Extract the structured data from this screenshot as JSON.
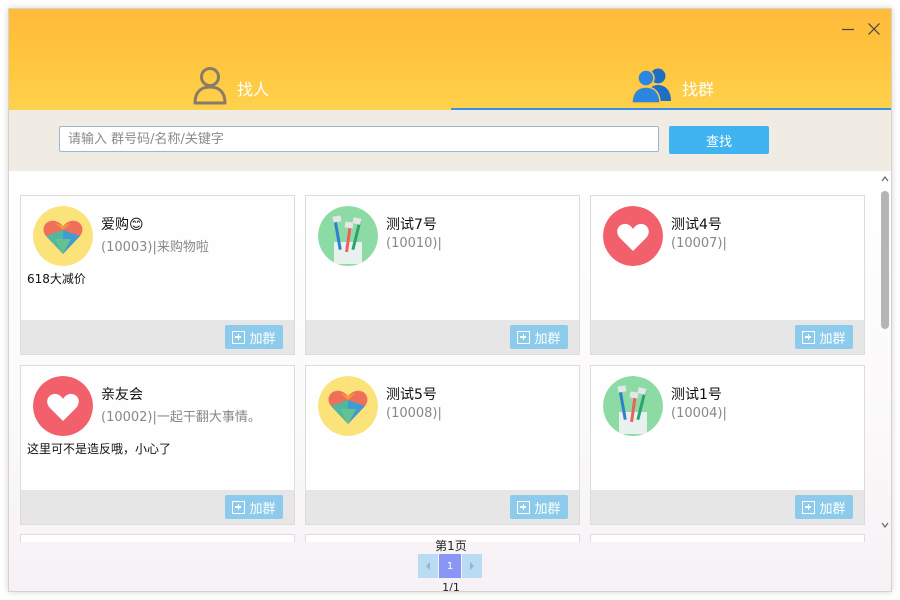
{
  "window": {
    "controls": {
      "minimize_icon": "minimize-icon",
      "close_icon": "close-icon"
    },
    "tabs": [
      {
        "label": "找人",
        "icon": "person-icon",
        "active": false
      },
      {
        "label": "找群",
        "icon": "group-icon",
        "active": true
      }
    ]
  },
  "search": {
    "placeholder": "请输入 群号码/名称/关键字",
    "value": "",
    "button_label": "查找"
  },
  "colors": {
    "header_gradient_top": "#ffbb3a",
    "tab_active_underline": "#3b8fe6",
    "search_button": "#3fb4f0",
    "join_button": "#8ccbeb",
    "page_current": "#8b95f5"
  },
  "groups": [
    {
      "name": "爱购😊",
      "sub": "(10003)|来购物啦",
      "desc": "618大减价",
      "avatar": "heart-gem-icon",
      "join_label": "加群"
    },
    {
      "name": "测试7号",
      "sub": "(10010)|",
      "desc": "",
      "avatar": "toothbrush-icon",
      "join_label": "加群"
    },
    {
      "name": "测试4号",
      "sub": "(10007)|",
      "desc": "",
      "avatar": "heart-icon",
      "join_label": "加群"
    },
    {
      "name": "亲友会",
      "sub": "(10002)|一起干翻大事情。",
      "desc": "这里可不是造反哦，小心了",
      "avatar": "heart-icon",
      "join_label": "加群"
    },
    {
      "name": "测试5号",
      "sub": "(10008)|",
      "desc": "",
      "avatar": "heart-gem-icon",
      "join_label": "加群"
    },
    {
      "name": "测试1号",
      "sub": "(10004)|",
      "desc": "",
      "avatar": "toothbrush-icon",
      "join_label": "加群"
    }
  ],
  "pagination": {
    "page_label": "第1页",
    "current": "1",
    "total": "1/1",
    "prev_icon": "chevron-left-icon",
    "next_icon": "chevron-right-icon"
  }
}
